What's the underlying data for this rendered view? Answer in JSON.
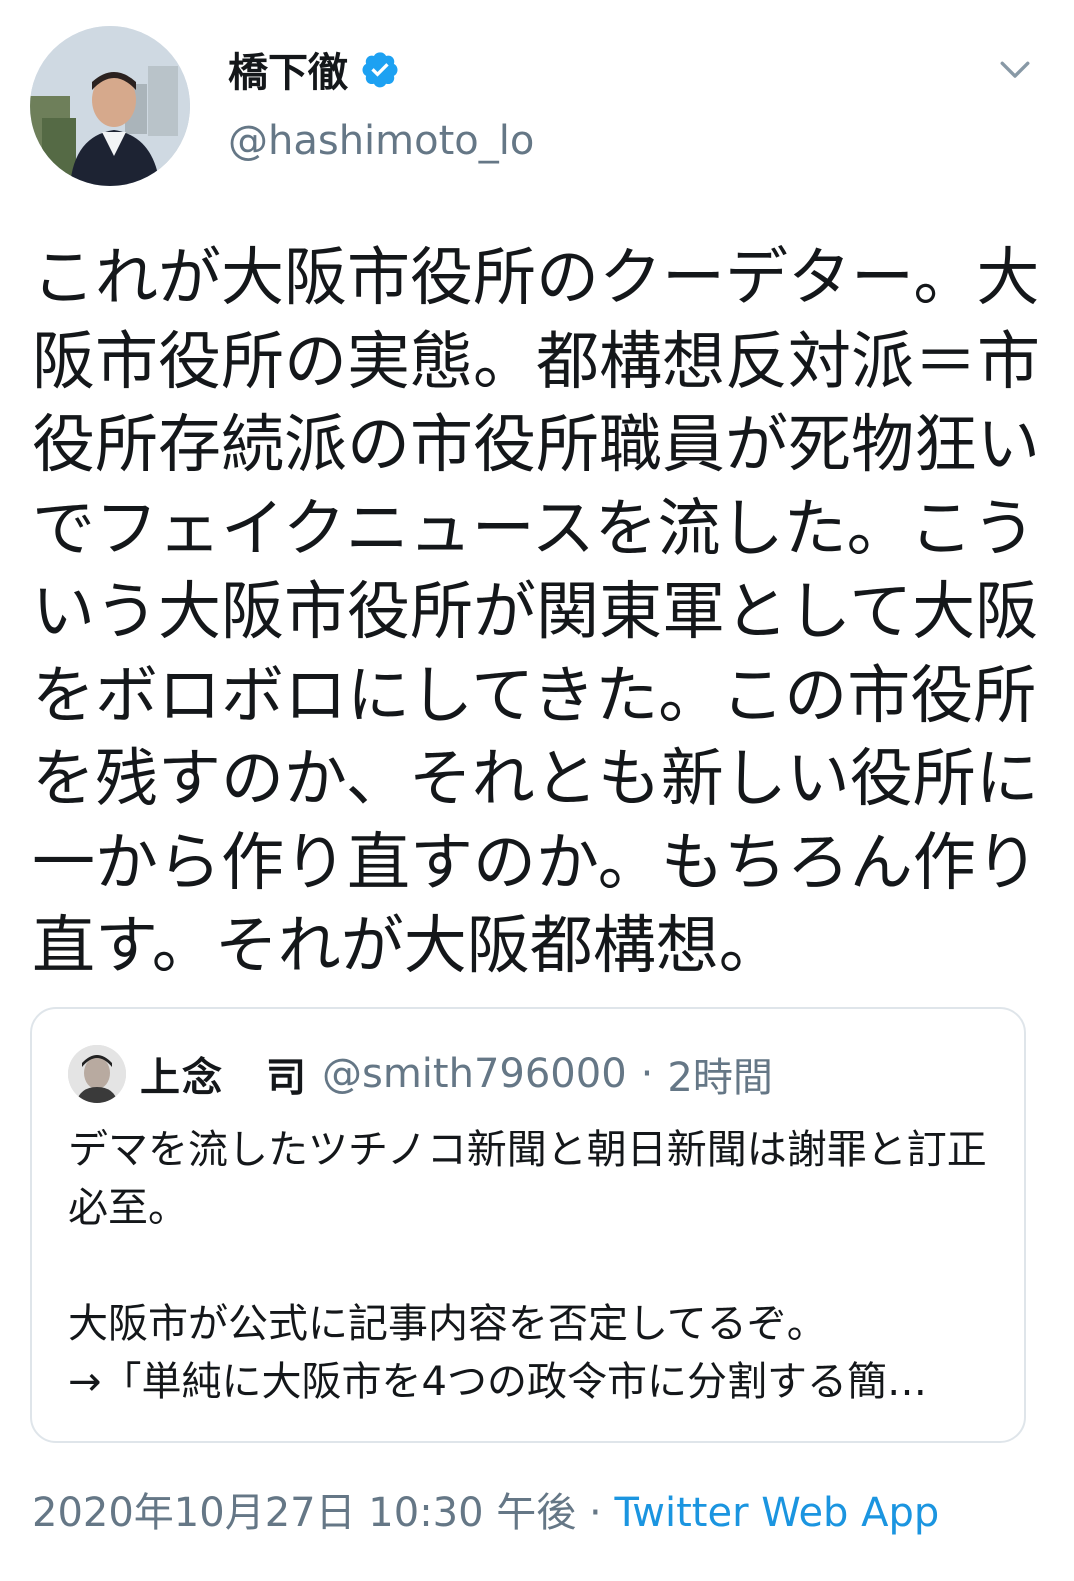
{
  "author": {
    "name": "橋下徹",
    "handle": "@hashimoto_lo",
    "verified": true
  },
  "tweet": {
    "text": "これが大阪市役所のクーデター。大阪市役所の実態。都構想反対派＝市役所存続派の市役所職員が死物狂いでフェイクニュースを流した。こういう大阪市役所が関東軍として大阪をボロボロにしてきた。この市役所を残すのか、それとも新しい役所に一から作り直すのか。もちろん作り直す。それが大阪都構想。"
  },
  "quoted_tweet": {
    "name": "上念　司",
    "handle": "@smith796000",
    "separator": "·",
    "time": "2時間",
    "text": "デマを流したツチノコ新聞と朝日新聞は謝罪と訂正必至。\n\n大阪市が公式に記事内容を否定してるぞ。\n→「単純に大阪市を4つの政令市に分割する簡…"
  },
  "meta": {
    "timestamp": "2020年10月27日 10:30 午後",
    "separator": " · ",
    "source": "Twitter Web App"
  },
  "icons": {
    "verified": "verified-badge-icon",
    "menu": "chevron-down-icon"
  },
  "colors": {
    "accent": "#1b95e0",
    "secondary_text": "#657786",
    "primary_text": "#14171a",
    "border": "#dfe5ea"
  }
}
